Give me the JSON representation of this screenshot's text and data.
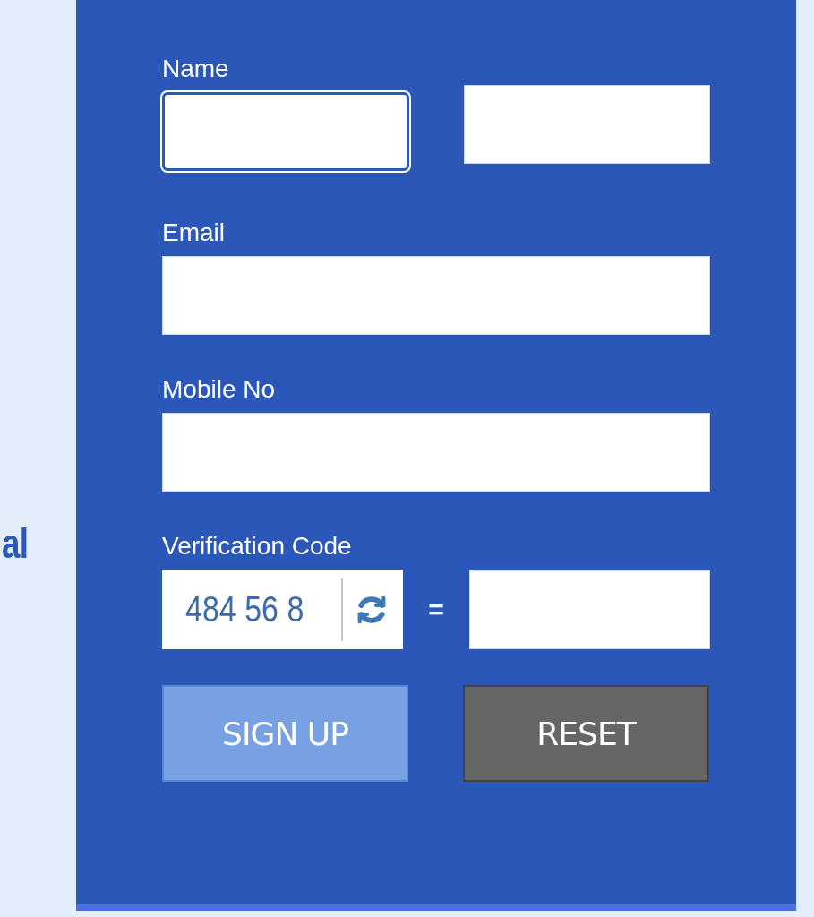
{
  "side_text": "al",
  "form": {
    "name": {
      "label": "Name",
      "focused": true
    },
    "email": {
      "label": "Email"
    },
    "mobile": {
      "label": "Mobile No"
    },
    "verification": {
      "label": "Verification Code",
      "captcha": "484 56 8",
      "equals": "="
    },
    "buttons": [
      {
        "kind": "primary",
        "label": "SIGN UP"
      },
      {
        "kind": "secondary",
        "label": "RESET"
      }
    ]
  }
}
